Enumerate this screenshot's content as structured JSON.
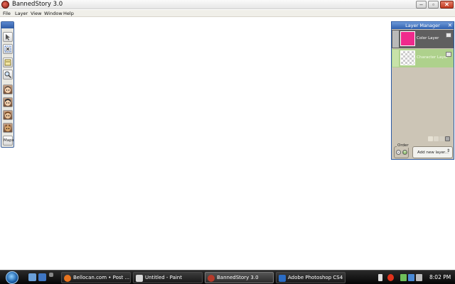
{
  "window": {
    "title": "BannedStory 3.0",
    "minimize_glyph": "–",
    "maximize_glyph": "▫",
    "close_glyph": "✕"
  },
  "menu": [
    "File",
    "Layer",
    "View",
    "Window",
    "Help"
  ],
  "toolbar": {
    "tools": [
      "pointer-icon",
      "transform-icon",
      "note-icon",
      "zoom-icon",
      "character-icon",
      "character-alt-icon",
      "npc-icon",
      "monster-icon",
      "maps-icon"
    ],
    "maps_label": "Maps"
  },
  "layer_manager": {
    "title": "Layer Manager",
    "close_glyph": "✕",
    "layers": [
      {
        "name": "Color Layer",
        "thumb_color": "#f02a8c"
      },
      {
        "name": "Character Layer",
        "thumb_color": "transparent"
      }
    ],
    "order_label": "Order",
    "order_down": "-",
    "order_up": "+",
    "add_layer_label": "Add new layer...",
    "add_layer_arrow": "⇕"
  },
  "taskbar": {
    "tasks": [
      {
        "label": "Bellocan.com • Post ...",
        "icon_color": "#e8741f",
        "active": false
      },
      {
        "label": "Untitled - Paint",
        "icon_color": "#d8d8d8",
        "active": false
      },
      {
        "label": "BannedStory 3.0",
        "icon_color": "#b53a2a",
        "active": true
      },
      {
        "label": "Adobe Photoshop CS4",
        "icon_color": "#2b6cc4",
        "active": false
      }
    ],
    "clock": "8:02 PM"
  },
  "colors": {
    "accent_blue": "#2d5aa5",
    "layer_selected": "#5f5f5f",
    "layer_alt": "#aed18c",
    "panel_bg": "#ccc5b6"
  }
}
